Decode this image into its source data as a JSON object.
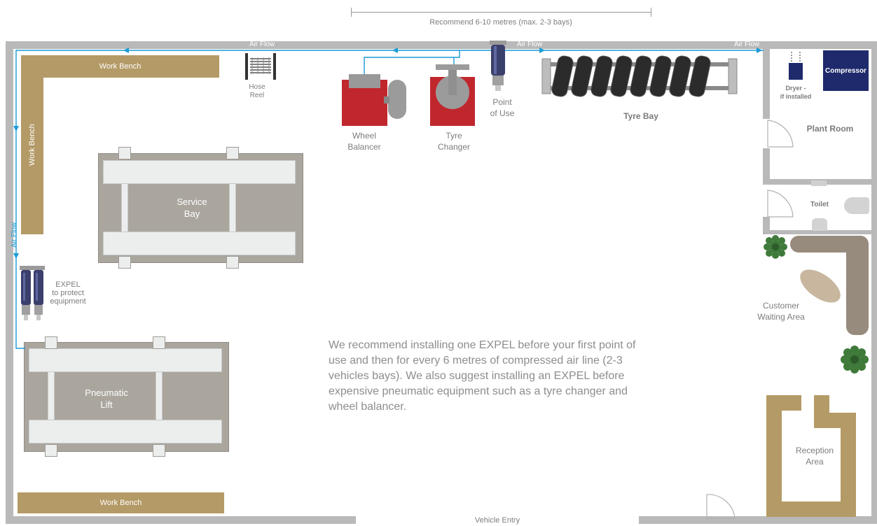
{
  "dimension": {
    "label": "Recommend 6-10 metres (max. 2-3 bays)"
  },
  "airflow": {
    "label": "Air Flow"
  },
  "benches": {
    "top": "Work Bench",
    "left": "Work Bench",
    "bottom": "Work Bench"
  },
  "equipment": {
    "hose_reel": "Hose\nReel",
    "wheel_balancer": "Wheel\nBalancer",
    "tyre_changer": "Tyre\nChanger",
    "point_of_use": "Point\nof Use",
    "tyre_bay": "Tyre Bay",
    "dryer": "Dryer -\nif installed",
    "compressor": "Compressor",
    "expel_protect": "EXPEL\nto protect\nequipment",
    "expel_mark": "expel"
  },
  "rooms": {
    "plant_room": "Plant Room",
    "toilet": "Toilet",
    "waiting": "Customer\nWaiting Area",
    "reception": "Reception\nArea",
    "vehicle_entry": "Vehicle Entry"
  },
  "bays": {
    "service": "Service\nBay",
    "lift": "Pneumatic\nLift"
  },
  "recommendation": "We recommend installing one EXPEL before your first point of use and then for every 6 metres of compressed air line (2-3 vehicles bays). We also suggest installing an EXPEL before expensive pneumatic equipment such as a tyre changer and wheel balancer.",
  "colors": {
    "airline": "#1a9bd7",
    "wall": "#b9b9b9",
    "bench": "#b49a66",
    "bay": "#aaa69e",
    "machine_red": "#c0272d",
    "compressor": "#1e2a6b"
  }
}
